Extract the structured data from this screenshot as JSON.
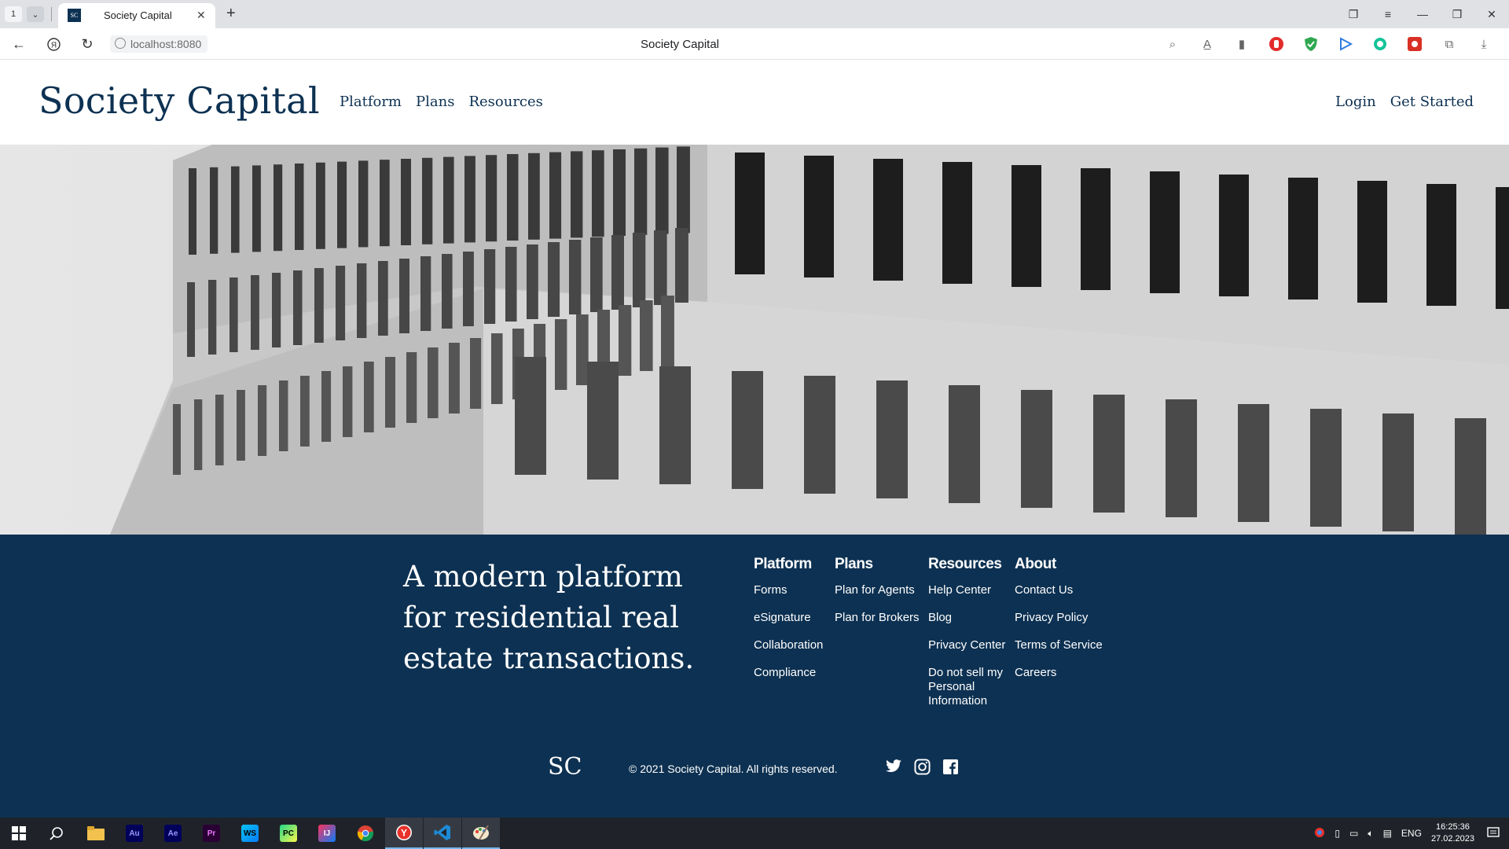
{
  "browser": {
    "tab_count": "1",
    "tab_title": "Society Capital",
    "favicon_text": "SC",
    "url": "localhost:8080",
    "page_title": "Society Capital"
  },
  "header": {
    "logo": "Society Capital",
    "nav": [
      "Platform",
      "Plans",
      "Resources"
    ],
    "login": "Login",
    "get_started": "Get Started"
  },
  "footer": {
    "tagline": "A modern platform for residential real estate transactions.",
    "columns": [
      {
        "title": "Platform",
        "links": [
          "Forms",
          "eSignature",
          "Collaboration",
          "Compliance"
        ]
      },
      {
        "title": "Plans",
        "links": [
          "Plan for Agents",
          "Plan for Brokers"
        ]
      },
      {
        "title": "Resources",
        "links": [
          "Help Center",
          "Blog",
          "Privacy Center",
          "Do not sell my Personal Information"
        ]
      },
      {
        "title": "About",
        "links": [
          "Contact Us",
          "Privacy Policy",
          "Terms of Service",
          "Careers"
        ]
      }
    ],
    "mark": "SC",
    "copyright": "© 2021 Society Capital. All rights reserved.",
    "social": [
      "twitter-icon",
      "instagram-icon",
      "facebook-icon"
    ]
  },
  "taskbar": {
    "apps": [
      "Au",
      "Ae",
      "Pr",
      "WS",
      "PC",
      "IJ"
    ],
    "lang": "ENG",
    "time": "16:25:36",
    "date": "27.02.2023"
  },
  "colors": {
    "brand_navy": "#0d3152",
    "white": "#ffffff"
  }
}
